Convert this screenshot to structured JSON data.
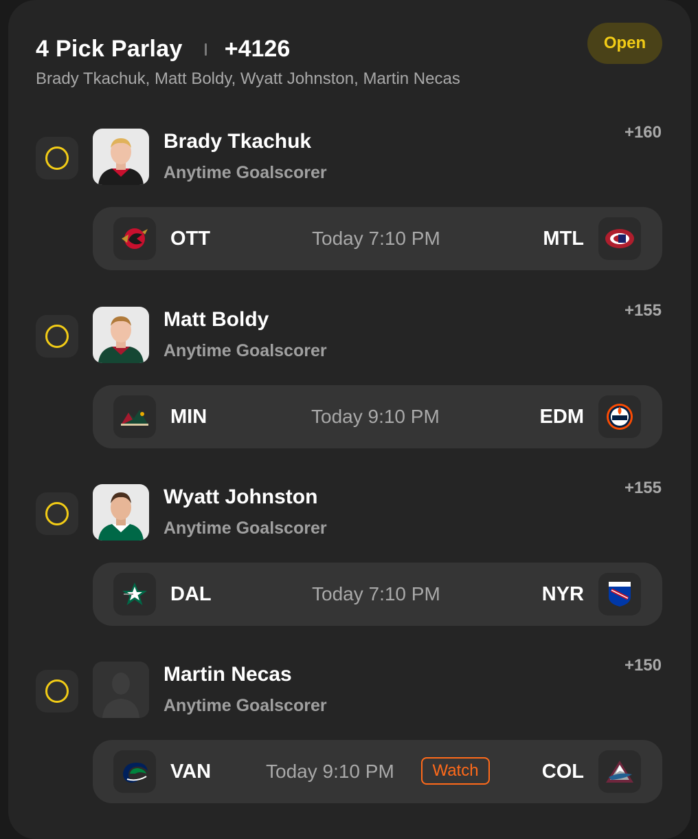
{
  "parlay": {
    "title": "4 Pick Parlay",
    "odds": "+4126",
    "players": "Brady Tkachuk, Matt Boldy, Wyatt Johnston, Martin Necas",
    "status": "Open"
  },
  "legs": [
    {
      "player": "Brady Tkachuk",
      "market": "Anytime Goalscorer",
      "odds": "+160",
      "away": "OTT",
      "home": "MTL",
      "time": "Today 7:10 PM",
      "away_logo_icon": "senators-logo-icon",
      "home_logo_icon": "canadiens-logo-icon"
    },
    {
      "player": "Matt Boldy",
      "market": "Anytime Goalscorer",
      "odds": "+155",
      "away": "MIN",
      "home": "EDM",
      "time": "Today 9:10 PM",
      "away_logo_icon": "wild-logo-icon",
      "home_logo_icon": "oilers-logo-icon"
    },
    {
      "player": "Wyatt Johnston",
      "market": "Anytime Goalscorer",
      "odds": "+155",
      "away": "DAL",
      "home": "NYR",
      "time": "Today 7:10 PM",
      "away_logo_icon": "stars-logo-icon",
      "home_logo_icon": "rangers-logo-icon"
    },
    {
      "player": "Martin Necas",
      "market": "Anytime Goalscorer",
      "odds": "+150",
      "away": "VAN",
      "home": "COL",
      "time": "Today 9:10 PM",
      "watch": "Watch",
      "away_logo_icon": "canucks-logo-icon",
      "home_logo_icon": "avalanche-logo-icon"
    }
  ],
  "colors": {
    "accent": "#f2cc16",
    "watch": "#ff6a1a",
    "card_bg": "#252525",
    "game_bg": "#353535"
  }
}
